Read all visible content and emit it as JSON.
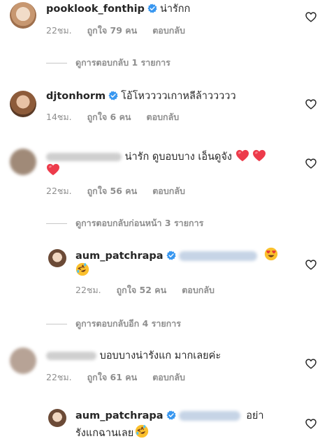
{
  "comments": [
    {
      "username": "pooklook_fonthip",
      "verified": true,
      "text": "น่ารักก",
      "time": "22ชม.",
      "likes": "ถูกใจ 79 คน",
      "reply": "ตอบกลับ",
      "view_replies": "ดูการตอบกลับ 1 รายการ"
    },
    {
      "username": "djtonhorm",
      "verified": true,
      "text": "โอ้โหววววเกาหลีล้าววววว",
      "time": "14ชม.",
      "likes": "ถูกใจ 6 คน",
      "reply": "ตอบกลับ"
    },
    {
      "username": "ja_chulimant",
      "verified": false,
      "text": "น่ารัก ดูบอบบาง เอ็นดูจัง",
      "time": "22ชม.",
      "likes": "ถูกใจ 56 คน",
      "reply": "ตอบกลับ",
      "view_replies": "ดูการตอบกลับก่อนหน้า 3 รายการ"
    },
    {
      "username": "aum_patchrapa",
      "verified": true,
      "time": "22ชม.",
      "likes": "ถูกใจ 52 คน",
      "reply": "ตอบกลับ",
      "view_replies": "ดูการตอบกลับอีก 4 รายการ"
    },
    {
      "username": "aummmy",
      "verified": false,
      "text": "บอบบางน่ารังแก มากเลยค่ะ",
      "time": "22ชม.",
      "likes": "ถูกใจ 61 คน",
      "reply": "ตอบกลับ"
    },
    {
      "username": "aum_patchrapa",
      "verified": true,
      "text_a": "อย่า",
      "text_b": "รังแกฉานเลย"
    }
  ],
  "colors": {
    "verified": "#3897f0",
    "heart_red": "#ed4956",
    "meta": "#8e8e8e"
  },
  "icons": {
    "like": "heart-outline-icon",
    "verified": "verified-badge-icon"
  }
}
